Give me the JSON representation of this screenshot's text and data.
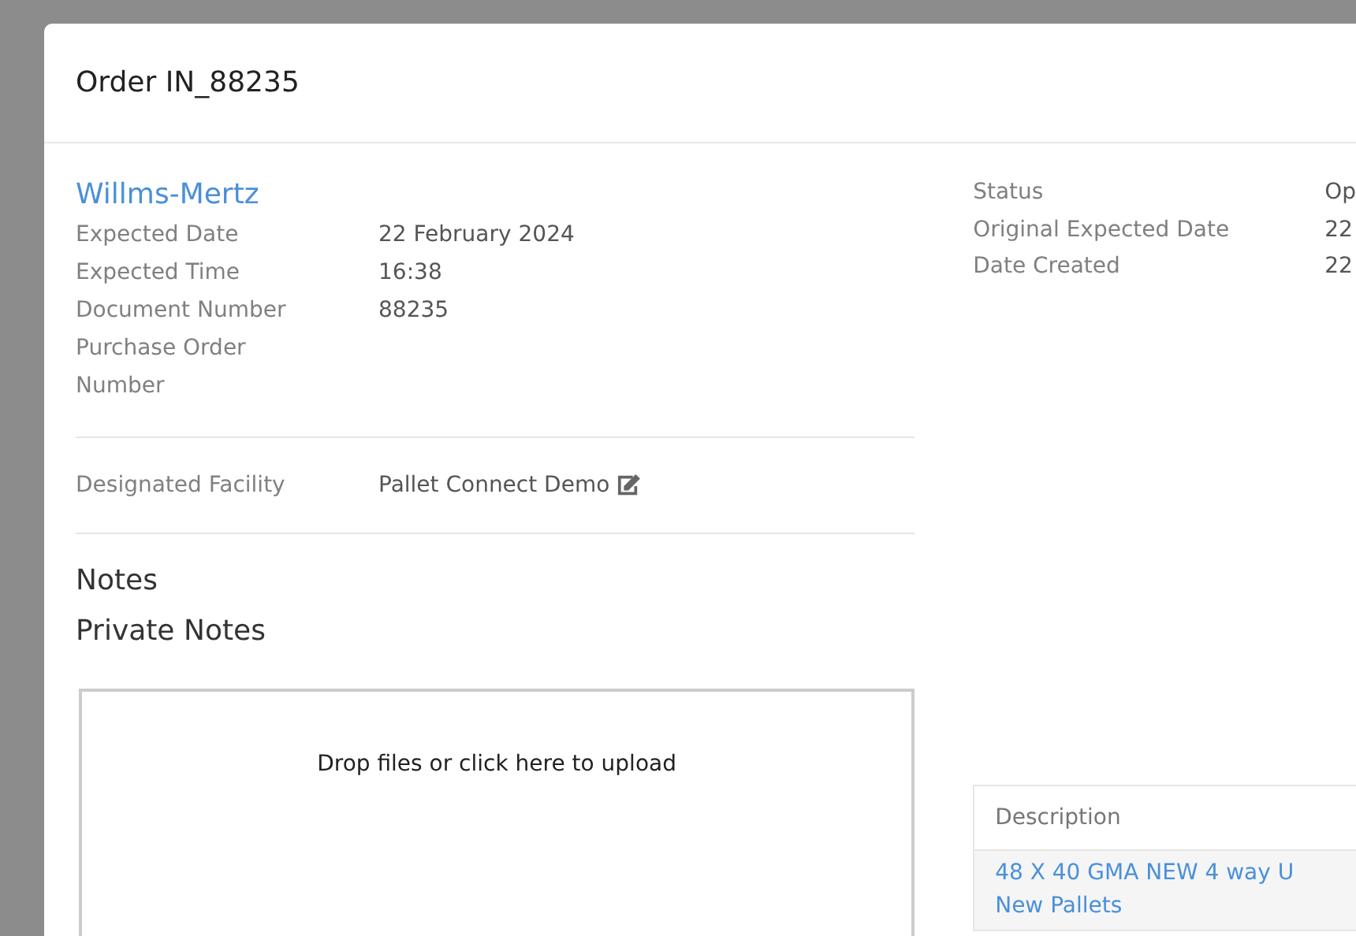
{
  "modal": {
    "title": "Order IN_88235"
  },
  "customer": {
    "name": "Willms-Mertz"
  },
  "details": [
    {
      "label": "Expected Date",
      "value": "22 February 2024"
    },
    {
      "label": "Expected Time",
      "value": "16:38"
    },
    {
      "label": "Document Number",
      "value": "88235"
    },
    {
      "label": "Purchase Order Number"
    }
  ],
  "facility": {
    "label": "Designated Facility",
    "value": "Pallet Connect Demo"
  },
  "notes": {
    "heading": "Notes",
    "private_heading": "Private Notes"
  },
  "upload": {
    "prompt": "Drop files or click here to upload"
  },
  "summary": [
    {
      "label": "Status",
      "value": "Op"
    },
    {
      "label": "Original Expected Date",
      "value": "22"
    },
    {
      "label": "Date Created",
      "value": "22"
    }
  ],
  "items_table": {
    "columns": [
      "Description"
    ],
    "rows": [
      {
        "description": "48 X 40 GMA NEW 4 way U",
        "category": "New Pallets"
      }
    ]
  }
}
